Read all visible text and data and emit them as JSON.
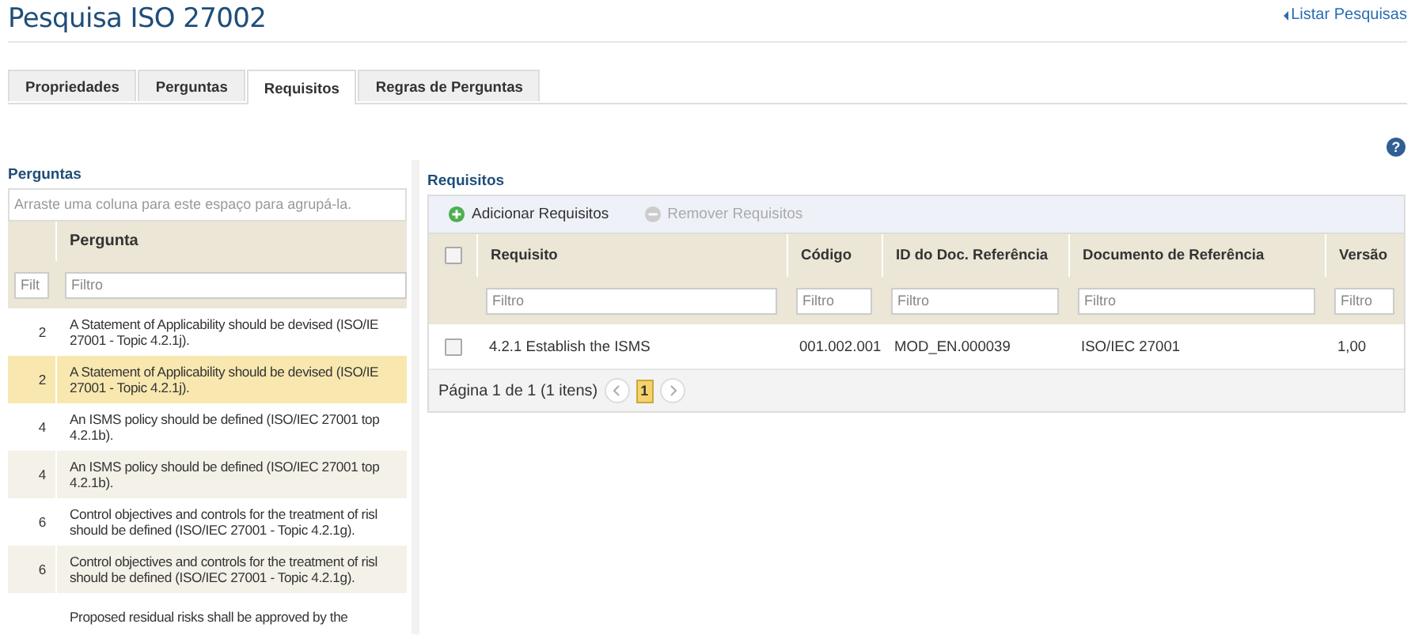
{
  "page": {
    "title": "Pesquisa ISO 27002",
    "back_link": "Listar Pesquisas",
    "help": "?"
  },
  "tabs": [
    {
      "label": "Propriedades",
      "selected": false
    },
    {
      "label": "Perguntas",
      "selected": false
    },
    {
      "label": "Requisitos",
      "selected": true
    },
    {
      "label": "Regras de Perguntas",
      "selected": false
    }
  ],
  "questions_panel": {
    "title": "Perguntas",
    "group_hint": "Arraste uma coluna para este espaço para agrupá-la.",
    "columns": [
      "Pergunta"
    ],
    "filter_placeholders": [
      "Filt",
      "Filtro"
    ],
    "rows": [
      {
        "number": "2",
        "text": "A Statement of Applicability should be devised (ISO/IE 27001 - Topic 4.2.1j).",
        "selected": false
      },
      {
        "number": "2",
        "text": "A Statement of Applicability should be devised (ISO/IE 27001 - Topic 4.2.1j).",
        "selected": true
      },
      {
        "number": "4",
        "text": "An ISMS policy should be defined (ISO/IEC 27001 top 4.2.1b).",
        "selected": false
      },
      {
        "number": "4",
        "text": "An ISMS policy should be defined (ISO/IEC 27001 top 4.2.1b).",
        "selected": false
      },
      {
        "number": "6",
        "text": "Control objectives and controls for the treatment of risl should be defined (ISO/IEC 27001 - Topic 4.2.1g).",
        "selected": false
      },
      {
        "number": "6",
        "text": "Control objectives and controls for the treatment of risl should be defined (ISO/IEC 27001 - Topic 4.2.1g).",
        "selected": false
      },
      {
        "number": "",
        "text": "Proposed residual risks shall be approved by the",
        "selected": false
      }
    ]
  },
  "requirements_panel": {
    "title": "Requisitos",
    "toolbar": [
      {
        "kind": "add",
        "label": "Adicionar Requisitos",
        "disabled": false
      },
      {
        "kind": "remove",
        "label": "Remover Requisitos",
        "disabled": true
      }
    ],
    "header_checked": false,
    "columns": [
      "Requisito",
      "Código",
      "ID do Doc. Referência",
      "Documento de Referência",
      "Versão"
    ],
    "filter_placeholders": [
      "Filtro",
      "Filtro",
      "Filtro",
      "Filtro",
      "Filtro"
    ],
    "rows": [
      {
        "checked": false,
        "cells": [
          "4.2.1 Establish the ISMS",
          "001.002.001",
          "MOD_EN.000039",
          "ISO/IEC 27001",
          "1,00"
        ]
      }
    ],
    "pager": {
      "summary": "Página 1 de 1 (1 itens)",
      "pages": [
        {
          "label": "1",
          "selected": true
        }
      ]
    }
  }
}
